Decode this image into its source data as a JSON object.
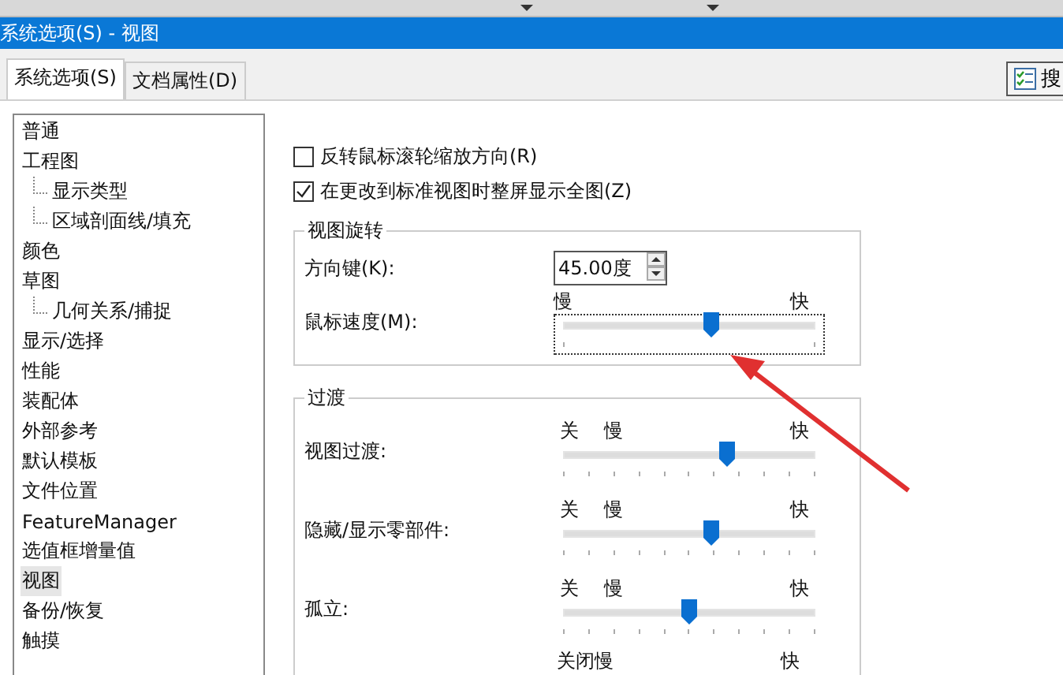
{
  "window": {
    "title": "系统选项(S) - 视图"
  },
  "tabs": [
    {
      "label": "系统选项(S)",
      "selected": true
    },
    {
      "label": "文档属性(D)",
      "selected": false
    }
  ],
  "search_button": {
    "label": "搜"
  },
  "sidebar": {
    "items": [
      {
        "label": "普通",
        "selected": false
      },
      {
        "label": "工程图",
        "selected": false,
        "children": [
          {
            "label": "显示类型",
            "selected": false
          },
          {
            "label": "区域剖面线/填充",
            "selected": false
          }
        ]
      },
      {
        "label": "颜色",
        "selected": false
      },
      {
        "label": "草图",
        "selected": false,
        "children": [
          {
            "label": "几何关系/捕捉",
            "selected": false
          }
        ]
      },
      {
        "label": "显示/选择",
        "selected": false
      },
      {
        "label": "性能",
        "selected": false
      },
      {
        "label": "装配体",
        "selected": false
      },
      {
        "label": "外部参考",
        "selected": false
      },
      {
        "label": "默认模板",
        "selected": false
      },
      {
        "label": "文件位置",
        "selected": false
      },
      {
        "label": "FeatureManager",
        "selected": false
      },
      {
        "label": "选值框增量值",
        "selected": false
      },
      {
        "label": "视图",
        "selected": true
      },
      {
        "label": "备份/恢复",
        "selected": false
      },
      {
        "label": "触摸",
        "selected": false
      }
    ]
  },
  "options": [
    {
      "label": "反转鼠标滚轮缩放方向(R)",
      "checked": false
    },
    {
      "label": "在更改到标准视图时整屏显示全图(Z)",
      "checked": true
    }
  ],
  "view_rotation": {
    "title": "视图旋转",
    "arrow_keys": {
      "label": "方向键(K):",
      "value": "45.00度"
    },
    "mouse_speed": {
      "label": "鼠标速度(M):",
      "slow": "慢",
      "fast": "快",
      "level": 0.59,
      "focused": true
    }
  },
  "transitions": {
    "title": "过渡",
    "sliders": [
      {
        "label": "视图过渡:",
        "off": "关",
        "slow": "慢",
        "fast": "快",
        "level": 0.65
      },
      {
        "label": "隐藏/显示零部件:",
        "off": "关",
        "slow": "慢",
        "fast": "快",
        "level": 0.59
      },
      {
        "label": "孤立:",
        "off": "关",
        "slow": "慢",
        "fast": "快",
        "level": 0.5
      }
    ],
    "cut_row": {
      "left": "关闭慢",
      "right": "快"
    }
  }
}
